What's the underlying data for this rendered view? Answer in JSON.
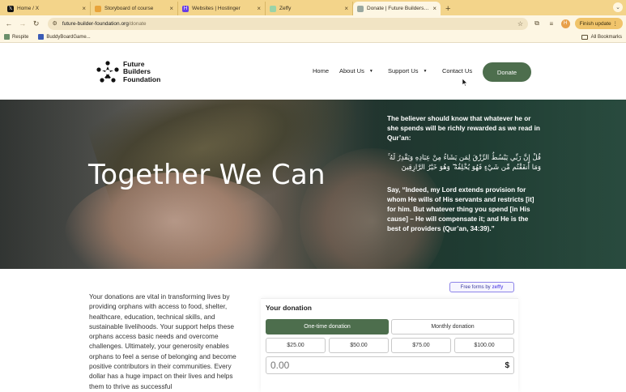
{
  "browser": {
    "tabs": [
      {
        "title": "Home / X",
        "favicon": "x-logo-icon",
        "color": "#111111"
      },
      {
        "title": "Storyboard of course",
        "favicon": "doc-icon",
        "color": "#e8a33a"
      },
      {
        "title": "Websites | Hostinger",
        "favicon": "hostinger-icon",
        "color": "#673de6"
      },
      {
        "title": "Zeffy",
        "favicon": "zeffy-icon",
        "color": "#9ad3a8"
      },
      {
        "title": "Donate | Future Builders Fou…",
        "favicon": "site-icon",
        "color": "#9aa8a0"
      }
    ],
    "new_tab": "+",
    "url_host": "future-builder-foundation.org",
    "url_path": "/donate",
    "profile_initial": "H",
    "finish_update": "Finish update",
    "bookmarks": [
      {
        "label": "Respite"
      },
      {
        "label": "BuddyBoardGame..."
      }
    ],
    "all_bookmarks": "All Bookmarks"
  },
  "site": {
    "logo_lines": [
      "Future",
      "Builders",
      "Foundation"
    ],
    "nav": [
      {
        "label": "Home"
      },
      {
        "label": "About Us"
      },
      {
        "label": "Support Us"
      },
      {
        "label": "Contact Us"
      }
    ],
    "donate_button": "Donate"
  },
  "hero": {
    "title": "Together We Can",
    "quote": "The believer should know that whatever he or she spends will be richly rewarded as we read in Qur’an:",
    "arabic": "قُلْ إِنَّ رَبِّي يَبْسُطُ الرِّزْقَ لِمَن يَشَاءُ مِنْ عِبَادِهِ وَيَقْدِرُ لَهُ ۚ وَمَا أَنفَقْتُم مِّن شَيْءٍ فَهُوَ يُخْلِفُهُ ۖ وَهُوَ خَيْرُ الرَّازِقِينَ",
    "translation": "Say, “Indeed, my Lord extends provision for whom He wills of His servants and restricts [it] for him. But whatever thing you spend [in His cause] – He will compensate it; and He is the best of providers (Qur’an, 34:39).”"
  },
  "content": {
    "body": "Your donations are vital in transforming lives by providing orphans with access to food, shelter, healthcare, education, technical skills, and sustainable livelihoods. Your support helps these orphans access basic needs and overcome challenges. Ultimately, your generosity enables orphans to feel a sense of belonging and become positive contributors in their communities. Every dollar has a huge impact on their lives and helps them to thrive as successful"
  },
  "form": {
    "badge_prefix": "Free forms by",
    "badge_brand": "zeffy",
    "title": "Your donation",
    "one_time": "One-time donation",
    "monthly": "Monthly donation",
    "amounts": [
      "$25.00",
      "$50.00",
      "$75.00",
      "$100.00"
    ],
    "amount_placeholder": "0.00",
    "currency": "$"
  },
  "colors": {
    "accent": "#4d6e4d",
    "chrome": "#f3d48a",
    "zeffy": "#6a5ce8"
  }
}
